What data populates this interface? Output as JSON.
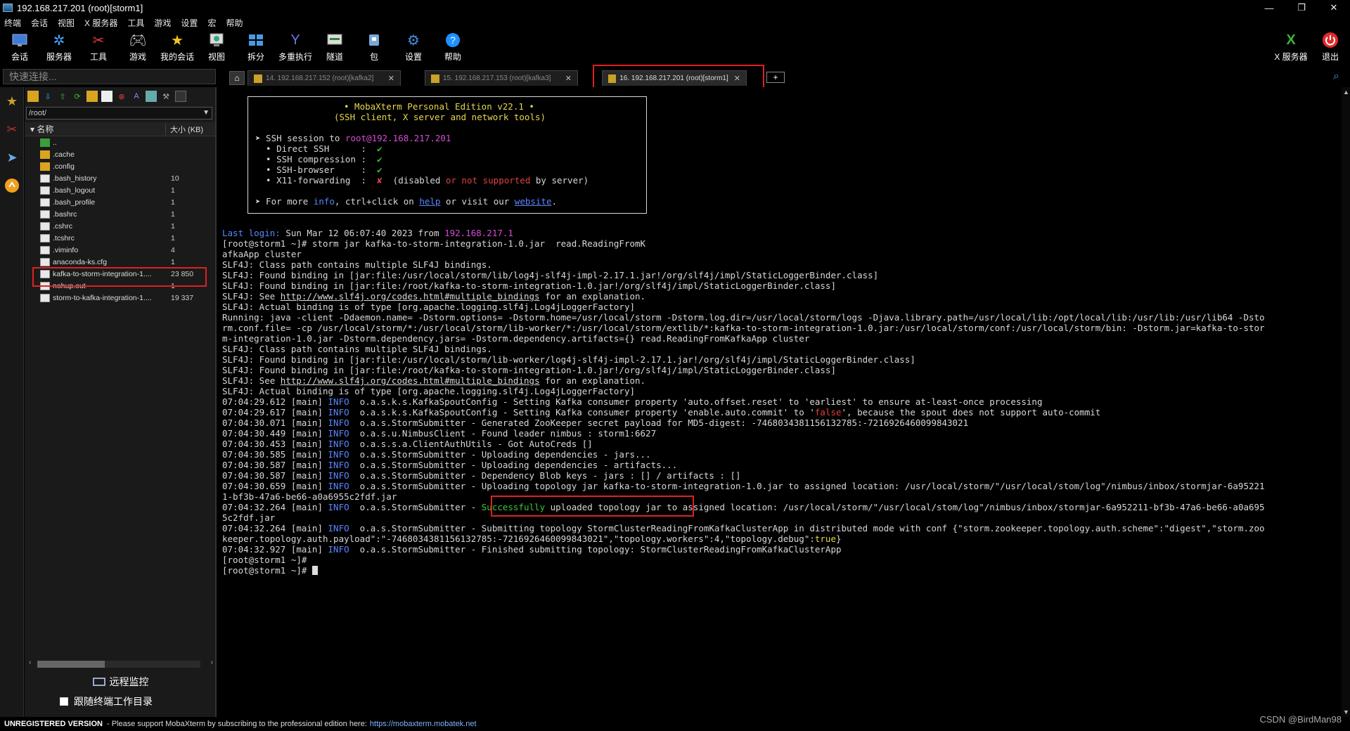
{
  "window": {
    "title": "192.168.217.201 (root)[storm1]",
    "min_glyph": "—",
    "restore_glyph": "❐",
    "close_glyph": "✕"
  },
  "menu": [
    "终端",
    "会话",
    "视图",
    "X 服务器",
    "工具",
    "游戏",
    "设置",
    "宏",
    "帮助"
  ],
  "toolbar": {
    "session": "会话",
    "servers": "服务器",
    "tools": "工具",
    "games": "游戏",
    "my_sessions": "我的会话",
    "view": "视图",
    "split": "拆分",
    "multiexec": "多重执行",
    "tunnel": "隧道",
    "packages": "包",
    "settings": "设置",
    "help": "帮助",
    "xserver": "X 服务器",
    "exit": "退出"
  },
  "quick_connect": {
    "placeholder": "快速连接..."
  },
  "tabs": [
    {
      "label": "14. 192.168.217.152 (root)[kafka2]",
      "close": "✕"
    },
    {
      "label": "15. 192.168.217.153 (root)[kafka3]",
      "close": "✕"
    },
    {
      "label": "16. 192.168.217.201 (root)[storm1]",
      "close": "✕"
    }
  ],
  "file_browser": {
    "path": "/root/",
    "col_name": "名称",
    "col_size": "大小 (KB)",
    "files": [
      {
        "name": "..",
        "size": "",
        "type": "up"
      },
      {
        "name": ".cache",
        "size": "",
        "type": "folder"
      },
      {
        "name": ".config",
        "size": "",
        "type": "folder"
      },
      {
        "name": ".bash_history",
        "size": "10",
        "type": "file"
      },
      {
        "name": ".bash_logout",
        "size": "1",
        "type": "file"
      },
      {
        "name": ".bash_profile",
        "size": "1",
        "type": "file"
      },
      {
        "name": ".bashrc",
        "size": "1",
        "type": "file"
      },
      {
        "name": ".cshrc",
        "size": "1",
        "type": "file"
      },
      {
        "name": ".tcshrc",
        "size": "1",
        "type": "file"
      },
      {
        "name": ".viminfo",
        "size": "4",
        "type": "file"
      },
      {
        "name": "anaconda-ks.cfg",
        "size": "1",
        "type": "file"
      },
      {
        "name": "kafka-to-storm-integration-1....",
        "size": "23 850",
        "type": "file"
      },
      {
        "name": "nohup.out",
        "size": "1",
        "type": "file"
      },
      {
        "name": "storm-to-kafka-integration-1....",
        "size": "19 337",
        "type": "file"
      }
    ],
    "remote_monitor": "远程监控",
    "follow_terminal": "跟随终端工作目录"
  },
  "banner": {
    "l1": "• MobaXterm Personal Edition v22.1 •",
    "l2": "(SSH client, X server and network tools)",
    "l3a": "➤ SSH session to ",
    "l3b": "root@192.168.217.201",
    "l4a": "  • Direct SSH      :  ",
    "l4b": "✔",
    "l5a": "  • SSH compression :  ",
    "l5b": "✔",
    "l6a": "  • SSH-browser     :  ",
    "l6b": "✔",
    "l7a": "  • X11-forwarding  :  ",
    "l7b": "✘",
    "l7c": "  (disabled ",
    "l7d": "or",
    "l7e": " not supported",
    "l7f": " by server)",
    "l8a": "➤ For more ",
    "l8b": "info",
    "l8c": ", ctrl+click on ",
    "l8d": "help",
    "l8e": " or visit our ",
    "l8f": "website",
    "l8g": "."
  },
  "terminal": {
    "last_login_a": "Last login:",
    "last_login_b": " Sun Mar 12 06:07:40 2023 from ",
    "last_login_ip": "192.168.217.1",
    "cmd1": "[root@storm1 ~]# storm jar kafka-to-storm-integration-1.0.jar  read.ReadingFromK",
    "cmd1b": "afkaApp cluster",
    "s1": "SLF4J: Class path contains multiple SLF4J bindings.",
    "s2": "SLF4J: Found binding in [jar:file:/usr/local/storm/lib/log4j-slf4j-impl-2.17.1.jar!/org/slf4j/impl/StaticLoggerBinder.class]",
    "s3": "SLF4J: Found binding in [jar:file:/root/kafka-to-storm-integration-1.0.jar!/org/slf4j/impl/StaticLoggerBinder.class]",
    "s4a": "SLF4J: See ",
    "s4link": "http://www.slf4j.org/codes.html#multiple_bindings",
    "s4b": " for an explanation.",
    "s5": "SLF4J: Actual binding is of type [org.apache.logging.slf4j.Log4jLoggerFactory]",
    "r1": "Running: java -client -Ddaemon.name= -Dstorm.options= -Dstorm.home=/usr/local/storm -Dstorm.log.dir=/usr/local/storm/logs -Djava.library.path=/usr/local/lib:/opt/local/lib:/usr/lib:/usr/lib64 -Dsto",
    "r2": "rm.conf.file= -cp /usr/local/storm/*:/usr/local/storm/lib-worker/*:/usr/local/storm/extlib/*:kafka-to-storm-integration-1.0.jar:/usr/local/storm/conf:/usr/local/storm/bin: -Dstorm.jar=kafka-to-stor",
    "r3": "m-integration-1.0.jar -Dstorm.dependency.jars= -Dstorm.dependency.artifacts={} read.ReadingFromKafkaApp cluster",
    "t1": "SLF4J: Class path contains multiple SLF4J bindings.",
    "t2": "SLF4J: Found binding in [jar:file:/usr/local/storm/lib-worker/log4j-slf4j-impl-2.17.1.jar!/org/slf4j/impl/StaticLoggerBinder.class]",
    "t3": "SLF4J: Found binding in [jar:file:/root/kafka-to-storm-integration-1.0.jar!/org/slf4j/impl/StaticLoggerBinder.class]",
    "t4a": "SLF4J: See ",
    "t4link": "http://www.slf4j.org/codes.html#multiple_bindings",
    "t4b": " for an explanation.",
    "t5": "SLF4J: Actual binding is of type [org.apache.logging.slf4j.Log4jLoggerFactory]",
    "info": "INFO",
    "l1a": "07:04:29.612 [main] ",
    "l1b": "  o.a.s.k.s.KafkaSpoutConfig - Setting Kafka consumer property 'auto.offset.reset' to 'earliest' to ensure at-least-once processing",
    "l2a": "07:04:29.617 [main] ",
    "l2b": "  o.a.s.k.s.KafkaSpoutConfig - Setting Kafka consumer property 'enable.auto.commit' to '",
    "l2false": "false",
    "l2c": "', because the spout does not support auto-commit",
    "l3a": "07:04:30.071 [main] ",
    "l3b": "  o.a.s.StormSubmitter - Generated ZooKeeper secret payload for MD5-digest: -7468034381156132785:-7216926460099843021",
    "l4a": "07:04:30.449 [main] ",
    "l4b": "  o.a.s.u.NimbusClient - Found leader nimbus : storm1:6627",
    "l5a": "07:04:30.453 [main] ",
    "l5b": "  o.a.s.s.a.ClientAuthUtils - Got AutoCreds []",
    "l6a": "07:04:30.585 [main] ",
    "l6b": "  o.a.s.StormSubmitter - Uploading dependencies - jars...",
    "l7a": "07:04:30.587 [main] ",
    "l7b": "  o.a.s.StormSubmitter - Uploading dependencies - artifacts...",
    "l8a": "07:04:30.587 [main] ",
    "l8b": "  o.a.s.StormSubmitter - Dependency Blob keys - jars : [] / artifacts : []",
    "l9a": "07:04:30.659 [main] ",
    "l9b": "  o.a.s.StormSubmitter - Uploading topology jar kafka-to-storm-integration-1.0.jar to assigned location: /usr/local/storm/\"/usr/local/stom/log\"/nimbus/inbox/stormjar-6a95221",
    "l9c": "1-bf3b-47a6-be66-a0a6955c2fdf.jar",
    "l10a": "07:04:32.264 [main] ",
    "l10b": "  o.a.s.StormSubmitter - ",
    "l10succ": "Successfully",
    "l10c": " uploaded topology jar to assigned location: /usr/local/storm/\"/usr/local/stom/log\"/nimbus/inbox/stormjar-6a952211-bf3b-47a6-be66-a0a695",
    "l10d": "5c2fdf.jar",
    "l11a": "07:04:32.264 [main] ",
    "l11b": "  o.a.s.StormSubmitter - Submitting topology StormClusterReadingFromKafkaClusterApp in distributed mode with conf {\"storm.zookeeper.topology.auth.scheme\":\"digest\",\"storm.zoo",
    "l11c": "keeper.topology.auth.payload\":\"-7468034381156132785:-7216926460099843021\",\"topology.workers\":4,\"topology.debug\":",
    "l11true": "true",
    "l11d": "}",
    "l12a": "07:04:32.927 [main] ",
    "l12b": "  o.a.s.StormSubmitter - Finished submitting topology: StormClusterReadingFromKafkaClusterApp",
    "p1": "[root@storm1 ~]#",
    "p2": "[root@storm1 ~]# "
  },
  "status": {
    "unregistered": "UNREGISTERED VERSION",
    "message": " -  Please support MobaXterm by subscribing to the professional edition here:",
    "link": "https://mobaxterm.mobatek.net"
  },
  "watermark": "CSDN @BirdMan98"
}
